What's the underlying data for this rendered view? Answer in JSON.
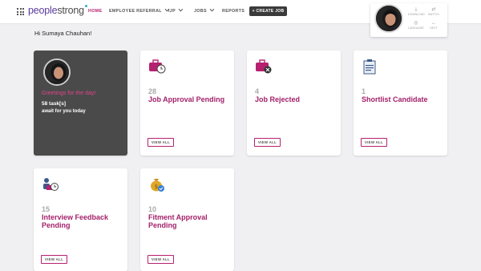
{
  "header": {
    "logo": {
      "part1": "people",
      "part2": "strong"
    },
    "nav": [
      {
        "label": "HOME",
        "active": true
      },
      {
        "label": "EMPLOYEE REFERRAL",
        "active": false,
        "dropdown": true
      },
      {
        "label": "IJP",
        "active": false,
        "dropdown": true
      },
      {
        "label": "JOBS",
        "active": false,
        "dropdown": true
      },
      {
        "label": "REPORTS",
        "active": false
      }
    ],
    "create_job_label": "+ CREATE JOB",
    "tools": [
      {
        "label": "DOWNLOAD",
        "icon": "download-icon"
      },
      {
        "label": "SWITCH",
        "icon": "switch-icon"
      },
      {
        "label": "LANGUAGE",
        "icon": "globe-icon"
      },
      {
        "label": "NEXT",
        "icon": "arrows-icon"
      }
    ]
  },
  "greeting": "Hi Sumaya Chauhan!",
  "summary_card": {
    "greeting": "Greetings for the day!",
    "tasks": "58 task[s]",
    "await": "await for you today"
  },
  "cards": [
    {
      "count": "28",
      "title": "Job Approval Pending",
      "button": "VIEW ALL",
      "icon": "briefcase-clock-icon"
    },
    {
      "count": "4",
      "title": "Job Rejected",
      "button": "VIEW ALL",
      "icon": "briefcase-rejected-icon"
    },
    {
      "count": "1",
      "title": "Shortlist Candidate",
      "button": "VIEW ALL",
      "icon": "clipboard-icon"
    },
    {
      "count": "15",
      "title": "Interview Feedback Pending",
      "button": "VIEW ALL",
      "icon": "interview-clock-icon"
    },
    {
      "count": "10",
      "title": "Fitment Approval Pending",
      "button": "VIEW ALL",
      "icon": "money-bag-check-icon"
    }
  ],
  "colors": {
    "accent": "#b5216f",
    "title": "#a3216a",
    "dark_card": "#4a4a4a"
  }
}
